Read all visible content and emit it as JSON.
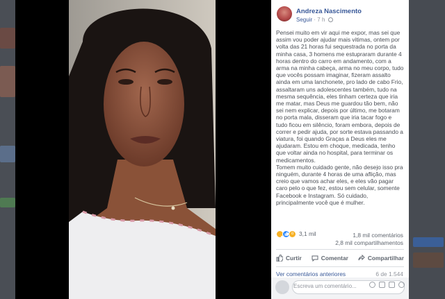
{
  "post": {
    "author": "Andreza Nascimento",
    "follow_label": "Seguir",
    "separator": "·",
    "time": "7 h",
    "paragraphs": [
      "Pensei muito em vir aqui me expor, mas sei que assim vou poder ajudar mais vitimas, ontem por volta das 21 horas fui sequestrada no porta da minha casa, 3 homens me estupraram durante 4 horas dentro do carro em andamento, com a arma na minha cabeça, arma no meu corpo, tudo que vocês possam imaginar, fizeram assalto ainda em uma lanchonete, pro lado de cabo Frio, assaltaram uns adolescentes também, tudo na mesma sequência, eles tinham certeza que iria me matar, mas Deus me guardou tão bem, não sei nem explicar, depois por último, me botaram no porta mala, disseram que iria tacar fogo e tudo ficou em silêncio, foram embora, depois de correr e pedir ajuda, por sorte estava passando a viatura, foi quando Graças a Deus eles me ajudaram. Estou em choque, medicada, tenho que voltar ainda no hospital, para terminar os medicamentos.",
      "Tomem muito cuidado gente, não desejo isso pra ninguém, durante 4 horas de uma aflição, mas creio que vamos achar eles, e eles vão pagar caro pelo o que fez, estou sem celular, somente Facebook e Instagram. Só cuidado, principalmente você que é mulher."
    ]
  },
  "stats": {
    "reactions_count": "3,1 mil",
    "reaction_icons": [
      "sad-reaction",
      "like-reaction",
      "wow-reaction"
    ],
    "comments": "1,8 mil comentários",
    "shares": "2,8 mil compartilhamentos"
  },
  "actions": {
    "like": "Curtir",
    "comment": "Comentar",
    "share": "Compartilhar"
  },
  "comments": {
    "previous_label": "Ver comentários anteriores",
    "page_count": "6 de 1.544",
    "input_placeholder": "Escreva um comentário..."
  },
  "colors": {
    "link": "#385898",
    "text": "#4b4f56",
    "muted": "#90949c"
  }
}
